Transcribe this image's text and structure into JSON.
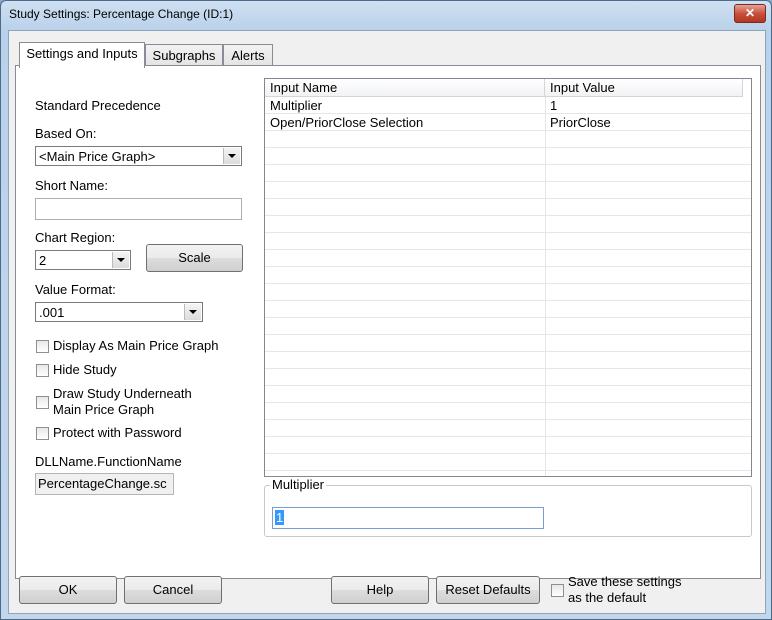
{
  "window": {
    "title": "Study Settings: Percentage Change (ID:1)",
    "close_glyph": "✕"
  },
  "tabs": [
    {
      "label": "Settings and Inputs"
    },
    {
      "label": "Subgraphs"
    },
    {
      "label": "Alerts"
    }
  ],
  "settings": {
    "standard_precedence": "Standard Precedence",
    "based_on_label": "Based On:",
    "based_on_value": "<Main Price Graph>",
    "short_name_label": "Short Name:",
    "short_name_value": "",
    "chart_region_label": "Chart Region:",
    "chart_region_value": "2",
    "scale_button": "Scale",
    "value_format_label": "Value Format:",
    "value_format_value": ".001",
    "checkboxes": [
      {
        "label": "Display As Main Price Graph",
        "checked": false
      },
      {
        "label": "Hide Study",
        "checked": false
      },
      {
        "label": "Draw Study Underneath",
        "label2": "Main Price Graph",
        "checked": false
      },
      {
        "label": "Protect with Password",
        "checked": false
      }
    ],
    "dll_label": "DLLName.FunctionName",
    "dll_value": "PercentageChange.sc"
  },
  "inputs_table": {
    "columns": [
      "Input Name",
      "Input Value"
    ],
    "rows": [
      {
        "name": "Multiplier",
        "value": "1"
      },
      {
        "name": "Open/PriorClose Selection",
        "value": "PriorClose"
      }
    ]
  },
  "editor": {
    "group_label": "Multiplier",
    "value": "1"
  },
  "footer": {
    "ok": "OK",
    "cancel": "Cancel",
    "help": "Help",
    "reset_defaults": "Reset Defaults",
    "save_default_line1": "Save these settings",
    "save_default_line2": "as the default"
  },
  "colors": {
    "selection": "#3399ff",
    "close_button": "#c7503c"
  }
}
